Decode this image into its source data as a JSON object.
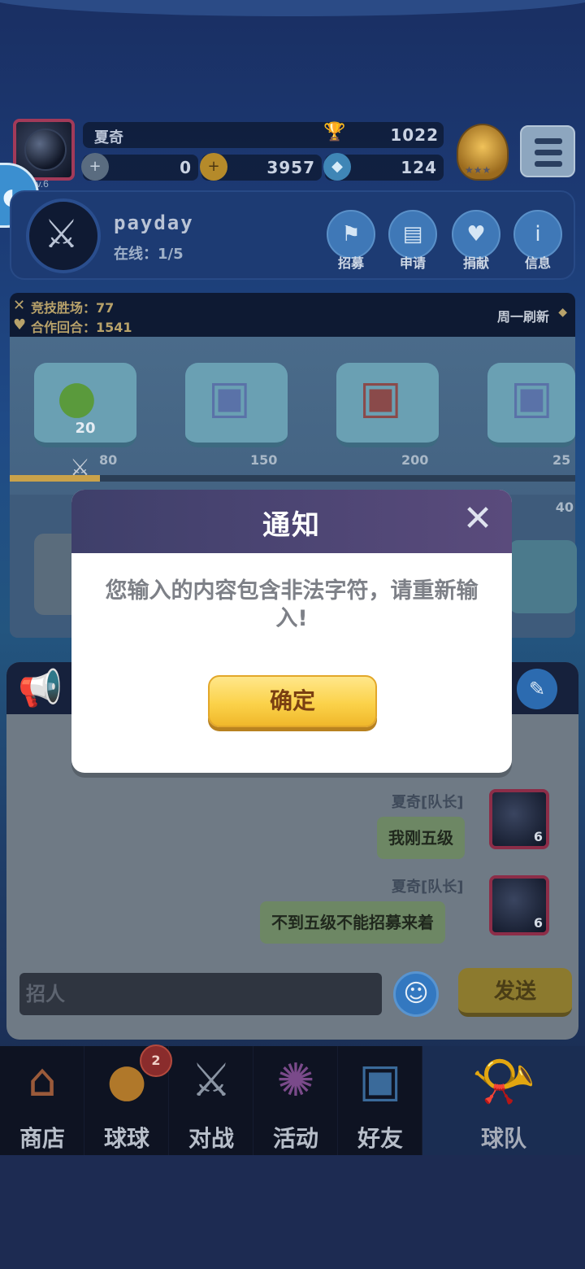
{
  "player": {
    "name": "夏奇",
    "level": "Lv.6",
    "trophies": "1022",
    "resource1": "0",
    "coins": "3957",
    "gems": "124"
  },
  "team": {
    "name": "payday",
    "online": "在线：1/5",
    "buttons": [
      {
        "label": "招募",
        "icon": "flag-icon"
      },
      {
        "label": "申请",
        "icon": "application-icon"
      },
      {
        "label": "捐献",
        "icon": "donate-heart-icon"
      },
      {
        "label": "信息",
        "icon": "info-icon"
      }
    ]
  },
  "activity": {
    "arena_wins": "竞技胜场：77",
    "coop_rounds": "合作回合：1541",
    "refresh": "周一刷新",
    "rewards": [
      {
        "count": "20",
        "icon": "mystery-ball-icon"
      },
      {
        "count": "",
        "icon": "gift-box-icon"
      },
      {
        "count": "",
        "icon": "treasure-chest-icon"
      },
      {
        "count": "",
        "icon": "gift-box-icon"
      }
    ],
    "milestones": [
      "80",
      "150",
      "200",
      "25"
    ],
    "progress": 0.16,
    "second_milestone": "40"
  },
  "chat": {
    "messages": [
      {
        "sender": "夏奇[队长]",
        "text": "我刚五级",
        "level": "6"
      },
      {
        "sender": "夏奇[队长]",
        "text": "不到五级不能招募来着",
        "level": "6"
      }
    ],
    "input_value": "招人",
    "send_label": "发送"
  },
  "nav": {
    "items": [
      {
        "label": "商店",
        "icon": "shop-icon"
      },
      {
        "label": "球球",
        "icon": "ball-icon",
        "badge": "2"
      },
      {
        "label": "对战",
        "icon": "crossed-swords-icon"
      },
      {
        "label": "活动",
        "icon": "party-popper-icon"
      },
      {
        "label": "好友",
        "icon": "friends-book-icon"
      }
    ],
    "active": {
      "label": "球队",
      "icon": "whistle-icon"
    }
  },
  "dialog": {
    "title": "通知",
    "message": "您输入的内容包含非法字符，请重新输入!",
    "confirm_label": "确定"
  },
  "colors": {
    "dialog_header": "#4a4572",
    "confirm_button": "#fbd24a",
    "accent_gold": "#c9a24a"
  }
}
